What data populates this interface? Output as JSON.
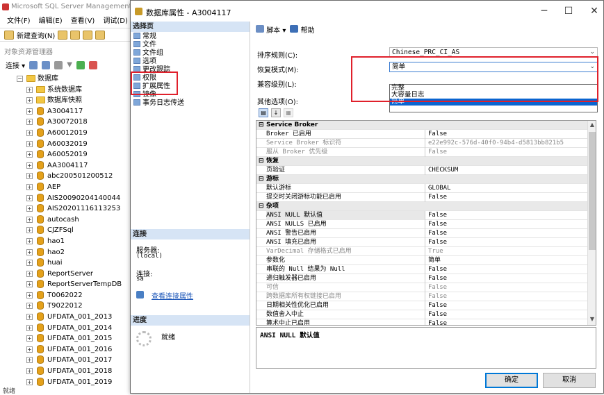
{
  "bg": {
    "title": "Microsoft SQL Server Management S",
    "menu": [
      "文件(F)",
      "编辑(E)",
      "查看(V)",
      "调试(D)"
    ],
    "new_query": "新建查询(N)",
    "oe_title": "对象资源管理器",
    "connect": "连接",
    "status": "就绪",
    "tree": {
      "root": "数据库",
      "system_db": "系统数据库",
      "snapshot": "数据库快照",
      "databases": [
        "A3004117",
        "A30072018",
        "A60012019",
        "A60032019",
        "A60052019",
        "AA3004117",
        "abc200501200512",
        "AEP",
        "AIS20090204140044",
        "AIS20201116113253",
        "autocash",
        "CJZFSql",
        "hao1",
        "hao2",
        "huai",
        "ReportServer",
        "ReportServerTempDB",
        "T0062022",
        "T9022012",
        "UFDATA_001_2013",
        "UFDATA_001_2014",
        "UFDATA_001_2015",
        "UFDATA_001_2016",
        "UFDATA_001_2017",
        "UFDATA_001_2018",
        "UFDATA_001_2019"
      ]
    }
  },
  "dialog": {
    "title": "数据库属性 - A3004117",
    "select_page": "选择页",
    "pages": [
      "常规",
      "文件",
      "文件组",
      "选项",
      "更改跟踪",
      "权限",
      "扩展属性",
      "镜像",
      "事务日志传送"
    ],
    "connection_head": "连接",
    "server_label": "服务器:",
    "server_value": "(local)",
    "conn_label": "连接:",
    "conn_value": "sa",
    "view_conn_props": "查看连接属性",
    "progress_head": "进度",
    "progress_status": "就绪",
    "script_btn": "脚本",
    "help_btn": "帮助",
    "collation_label": "排序规则(C):",
    "collation_value": "Chinese_PRC_CI_AS",
    "recovery_label": "恢复模式(M):",
    "recovery_value": "简单",
    "recovery_options": [
      "完整",
      "大容量日志",
      "简单"
    ],
    "recovery_selected_index": 2,
    "compat_label": "兼容级别(L):",
    "other_label": "其他选项(O):",
    "grid": [
      {
        "type": "cat",
        "name": "Service Broker"
      },
      {
        "name": "Broker 已启用",
        "value": "False"
      },
      {
        "name": "Service Broker 标识符",
        "value": "e22e992c-576d-40f0-94b4-d5813bb821b5",
        "disabled": true
      },
      {
        "name": "服从 Broker 优先级",
        "value": "False",
        "disabled": true
      },
      {
        "type": "cat",
        "name": "恢复"
      },
      {
        "name": "页验证",
        "value": "CHECKSUM"
      },
      {
        "type": "cat",
        "name": "游标"
      },
      {
        "name": "默认游标",
        "value": "GLOBAL"
      },
      {
        "name": "提交时关闭游标功能已启用",
        "value": "False"
      },
      {
        "type": "cat",
        "name": "杂项"
      },
      {
        "name": "ANSI NULL 默认值",
        "value": "False",
        "selected": true
      },
      {
        "name": "ANSI NULLS 已启用",
        "value": "False"
      },
      {
        "name": "ANSI 警告已启用",
        "value": "False"
      },
      {
        "name": "ANSI 填充已启用",
        "value": "False"
      },
      {
        "name": "VarDecimal 存储格式已启用",
        "value": "True",
        "disabled": true
      },
      {
        "name": "参数化",
        "value": "简单"
      },
      {
        "name": "串联的 Null 结果为 Null",
        "value": "False"
      },
      {
        "name": "递归触发器已启用",
        "value": "False"
      },
      {
        "name": "可信",
        "value": "False",
        "disabled": true
      },
      {
        "name": "跨数据库所有权链接已启用",
        "value": "False",
        "disabled": true
      },
      {
        "name": "日期相关性优化已启用",
        "value": "False"
      },
      {
        "name": "数值舍入中止",
        "value": "False"
      },
      {
        "name": "算术中止已启用",
        "value": "False"
      }
    ],
    "description": "ANSI NULL 默认值",
    "ok": "确定",
    "cancel": "取消"
  },
  "colors": {
    "highlight_red": "#e0202b",
    "selection_blue": "#0a64d0",
    "section_bg": "#d6e4f5"
  }
}
